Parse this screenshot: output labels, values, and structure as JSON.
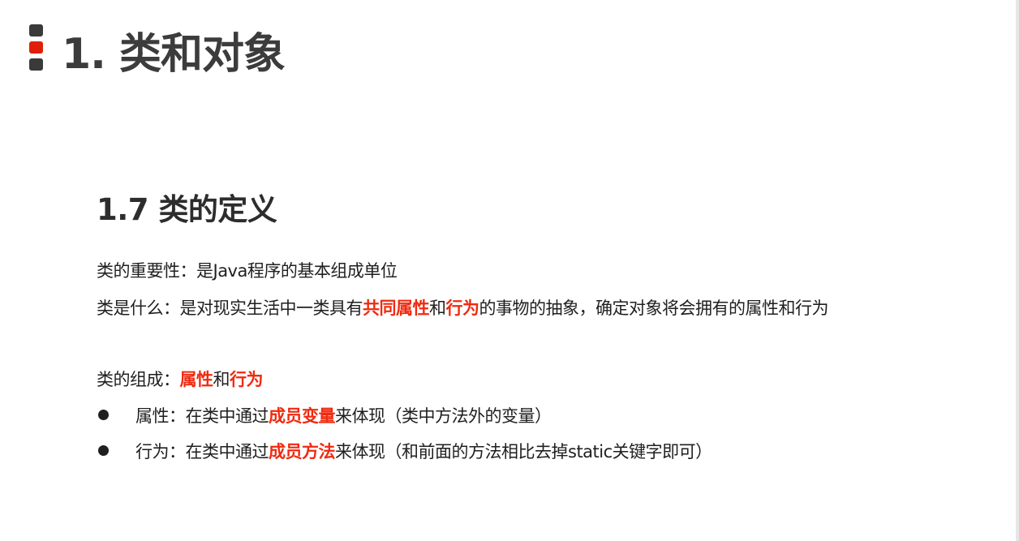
{
  "colors": {
    "accent_red": "#e01f0b",
    "marker_dark": "#3a3a3a",
    "highlight": "#f02a10",
    "text": "#1f1f1f"
  },
  "title": {
    "number": "1.",
    "text": "类和对象"
  },
  "section": {
    "number": "1.7",
    "text": "类的定义"
  },
  "importance": {
    "label": "类的重要性：",
    "text": "是Java程序的基本组成单位"
  },
  "definition": {
    "label": "类是什么：",
    "text_1": "是对现实生活中一类具有",
    "hl_1": "共同属性",
    "text_2": "和",
    "hl_2": "行为",
    "text_3": "的事物的抽象，确定对象将会拥有的属性和行为"
  },
  "composition": {
    "label": "类的组成：",
    "hl_1": "属性",
    "text_1": "和",
    "hl_2": "行为"
  },
  "bullets": [
    {
      "label": "属性：",
      "text_1": "在类中通过",
      "hl": "成员变量",
      "text_2": "来体现（类中方法外的变量）"
    },
    {
      "label": "行为：",
      "text_1": "在类中通过",
      "hl": "成员方法",
      "text_2": "来体现（和前面的方法相比去掉static关键字即可）"
    }
  ]
}
